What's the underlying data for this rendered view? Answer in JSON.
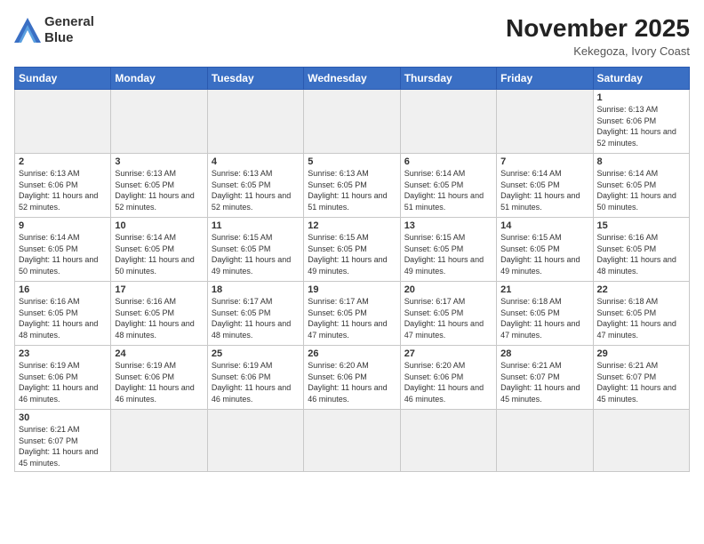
{
  "logo": {
    "line1": "General",
    "line2": "Blue"
  },
  "title": "November 2025",
  "subtitle": "Kekegoza, Ivory Coast",
  "days_header": [
    "Sunday",
    "Monday",
    "Tuesday",
    "Wednesday",
    "Thursday",
    "Friday",
    "Saturday"
  ],
  "weeks": [
    [
      {
        "day": "",
        "empty": true
      },
      {
        "day": "",
        "empty": true
      },
      {
        "day": "",
        "empty": true
      },
      {
        "day": "",
        "empty": true
      },
      {
        "day": "",
        "empty": true
      },
      {
        "day": "",
        "empty": true
      },
      {
        "day": "1",
        "sunrise": "Sunrise: 6:13 AM",
        "sunset": "Sunset: 6:06 PM",
        "daylight": "Daylight: 11 hours and 52 minutes."
      }
    ],
    [
      {
        "day": "2",
        "sunrise": "Sunrise: 6:13 AM",
        "sunset": "Sunset: 6:06 PM",
        "daylight": "Daylight: 11 hours and 52 minutes."
      },
      {
        "day": "3",
        "sunrise": "Sunrise: 6:13 AM",
        "sunset": "Sunset: 6:05 PM",
        "daylight": "Daylight: 11 hours and 52 minutes."
      },
      {
        "day": "4",
        "sunrise": "Sunrise: 6:13 AM",
        "sunset": "Sunset: 6:05 PM",
        "daylight": "Daylight: 11 hours and 52 minutes."
      },
      {
        "day": "5",
        "sunrise": "Sunrise: 6:13 AM",
        "sunset": "Sunset: 6:05 PM",
        "daylight": "Daylight: 11 hours and 51 minutes."
      },
      {
        "day": "6",
        "sunrise": "Sunrise: 6:14 AM",
        "sunset": "Sunset: 6:05 PM",
        "daylight": "Daylight: 11 hours and 51 minutes."
      },
      {
        "day": "7",
        "sunrise": "Sunrise: 6:14 AM",
        "sunset": "Sunset: 6:05 PM",
        "daylight": "Daylight: 11 hours and 51 minutes."
      },
      {
        "day": "8",
        "sunrise": "Sunrise: 6:14 AM",
        "sunset": "Sunset: 6:05 PM",
        "daylight": "Daylight: 11 hours and 50 minutes."
      }
    ],
    [
      {
        "day": "9",
        "sunrise": "Sunrise: 6:14 AM",
        "sunset": "Sunset: 6:05 PM",
        "daylight": "Daylight: 11 hours and 50 minutes."
      },
      {
        "day": "10",
        "sunrise": "Sunrise: 6:14 AM",
        "sunset": "Sunset: 6:05 PM",
        "daylight": "Daylight: 11 hours and 50 minutes."
      },
      {
        "day": "11",
        "sunrise": "Sunrise: 6:15 AM",
        "sunset": "Sunset: 6:05 PM",
        "daylight": "Daylight: 11 hours and 49 minutes."
      },
      {
        "day": "12",
        "sunrise": "Sunrise: 6:15 AM",
        "sunset": "Sunset: 6:05 PM",
        "daylight": "Daylight: 11 hours and 49 minutes."
      },
      {
        "day": "13",
        "sunrise": "Sunrise: 6:15 AM",
        "sunset": "Sunset: 6:05 PM",
        "daylight": "Daylight: 11 hours and 49 minutes."
      },
      {
        "day": "14",
        "sunrise": "Sunrise: 6:15 AM",
        "sunset": "Sunset: 6:05 PM",
        "daylight": "Daylight: 11 hours and 49 minutes."
      },
      {
        "day": "15",
        "sunrise": "Sunrise: 6:16 AM",
        "sunset": "Sunset: 6:05 PM",
        "daylight": "Daylight: 11 hours and 48 minutes."
      }
    ],
    [
      {
        "day": "16",
        "sunrise": "Sunrise: 6:16 AM",
        "sunset": "Sunset: 6:05 PM",
        "daylight": "Daylight: 11 hours and 48 minutes."
      },
      {
        "day": "17",
        "sunrise": "Sunrise: 6:16 AM",
        "sunset": "Sunset: 6:05 PM",
        "daylight": "Daylight: 11 hours and 48 minutes."
      },
      {
        "day": "18",
        "sunrise": "Sunrise: 6:17 AM",
        "sunset": "Sunset: 6:05 PM",
        "daylight": "Daylight: 11 hours and 48 minutes."
      },
      {
        "day": "19",
        "sunrise": "Sunrise: 6:17 AM",
        "sunset": "Sunset: 6:05 PM",
        "daylight": "Daylight: 11 hours and 47 minutes."
      },
      {
        "day": "20",
        "sunrise": "Sunrise: 6:17 AM",
        "sunset": "Sunset: 6:05 PM",
        "daylight": "Daylight: 11 hours and 47 minutes."
      },
      {
        "day": "21",
        "sunrise": "Sunrise: 6:18 AM",
        "sunset": "Sunset: 6:05 PM",
        "daylight": "Daylight: 11 hours and 47 minutes."
      },
      {
        "day": "22",
        "sunrise": "Sunrise: 6:18 AM",
        "sunset": "Sunset: 6:05 PM",
        "daylight": "Daylight: 11 hours and 47 minutes."
      }
    ],
    [
      {
        "day": "23",
        "sunrise": "Sunrise: 6:19 AM",
        "sunset": "Sunset: 6:06 PM",
        "daylight": "Daylight: 11 hours and 46 minutes."
      },
      {
        "day": "24",
        "sunrise": "Sunrise: 6:19 AM",
        "sunset": "Sunset: 6:06 PM",
        "daylight": "Daylight: 11 hours and 46 minutes."
      },
      {
        "day": "25",
        "sunrise": "Sunrise: 6:19 AM",
        "sunset": "Sunset: 6:06 PM",
        "daylight": "Daylight: 11 hours and 46 minutes."
      },
      {
        "day": "26",
        "sunrise": "Sunrise: 6:20 AM",
        "sunset": "Sunset: 6:06 PM",
        "daylight": "Daylight: 11 hours and 46 minutes."
      },
      {
        "day": "27",
        "sunrise": "Sunrise: 6:20 AM",
        "sunset": "Sunset: 6:06 PM",
        "daylight": "Daylight: 11 hours and 46 minutes."
      },
      {
        "day": "28",
        "sunrise": "Sunrise: 6:21 AM",
        "sunset": "Sunset: 6:07 PM",
        "daylight": "Daylight: 11 hours and 45 minutes."
      },
      {
        "day": "29",
        "sunrise": "Sunrise: 6:21 AM",
        "sunset": "Sunset: 6:07 PM",
        "daylight": "Daylight: 11 hours and 45 minutes."
      }
    ],
    [
      {
        "day": "30",
        "sunrise": "Sunrise: 6:21 AM",
        "sunset": "Sunset: 6:07 PM",
        "daylight": "Daylight: 11 hours and 45 minutes."
      },
      {
        "day": "",
        "empty": true
      },
      {
        "day": "",
        "empty": true
      },
      {
        "day": "",
        "empty": true
      },
      {
        "day": "",
        "empty": true
      },
      {
        "day": "",
        "empty": true
      },
      {
        "day": "",
        "empty": true
      }
    ]
  ]
}
